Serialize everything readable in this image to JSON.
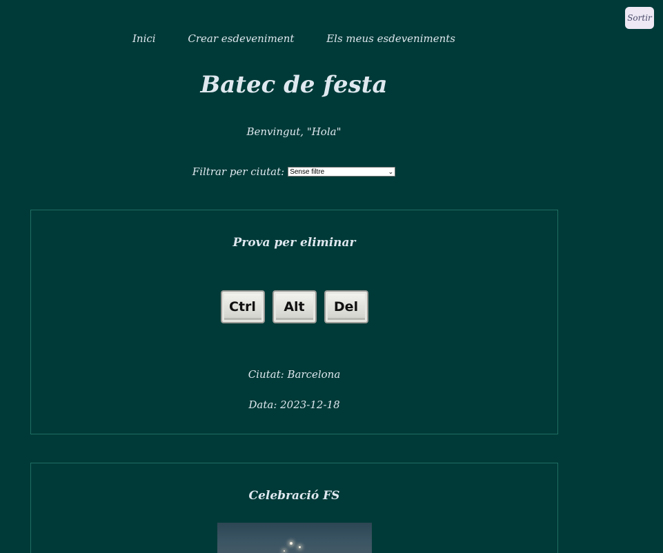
{
  "header": {
    "logout_label": "Sortir"
  },
  "nav": {
    "items": [
      {
        "label": "Inici"
      },
      {
        "label": "Crear esdeveniment"
      },
      {
        "label": "Els meus esdeveniments"
      }
    ]
  },
  "page": {
    "title": "Batec de festa",
    "welcome": "Benvingut, \"Hola\""
  },
  "filter": {
    "label": "Filtrar per ciutat:",
    "selected": "Sense filtre",
    "chevron_icon": "chevron-down-icon"
  },
  "events": [
    {
      "title": "Prova per eliminar",
      "image_keys": [
        "Ctrl",
        "Alt",
        "Del"
      ],
      "city": "Ciutat: Barcelona",
      "date": "Data: 2023-12-18"
    },
    {
      "title": "Celebració FS",
      "image": "night-street-photo"
    }
  ],
  "colors": {
    "background": "#003a38",
    "card_border": "#1f6e64",
    "text": "#dfe8ef",
    "button_bg": "#ede8f4"
  }
}
